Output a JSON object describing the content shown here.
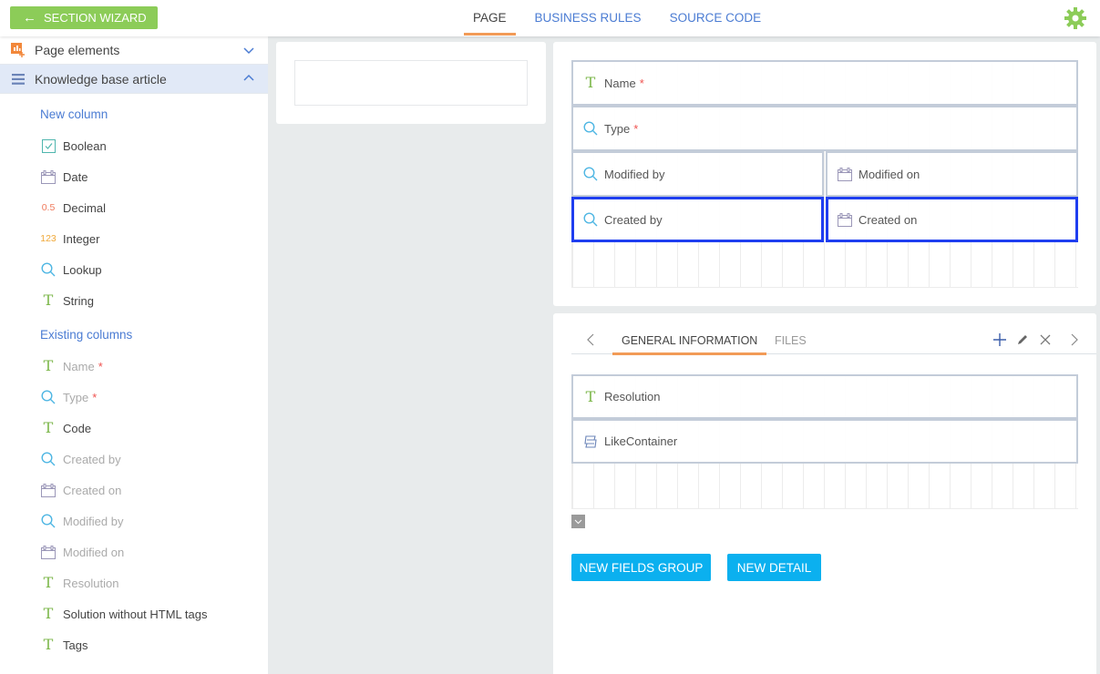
{
  "header": {
    "back_button_label": "SECTION WIZARD",
    "tabs": [
      {
        "label": "PAGE",
        "active": true
      },
      {
        "label": "BUSINESS RULES",
        "active": false
      },
      {
        "label": "SOURCE CODE",
        "active": false
      }
    ],
    "settings_icon": "gear-icon"
  },
  "colors": {
    "accent_green": "#8ccc58",
    "link_blue": "#4b7cd3",
    "tab_underline": "#f29b57",
    "selection_blue": "#1f3ef0",
    "button_blue": "#0bb0ef",
    "required_red": "#ef5350"
  },
  "sidebar": {
    "page_elements_label": "Page elements",
    "object_label": "Knowledge base article",
    "new_column_heading": "New column",
    "new_columns": [
      {
        "label": "Boolean",
        "icon": "checkbox-icon"
      },
      {
        "label": "Date",
        "icon": "calendar-icon"
      },
      {
        "label": "Decimal",
        "icon": "decimal-icon",
        "glyph": "0.5"
      },
      {
        "label": "Integer",
        "icon": "integer-icon",
        "glyph": "123"
      },
      {
        "label": "Lookup",
        "icon": "search-icon"
      },
      {
        "label": "String",
        "icon": "text-icon",
        "glyph": "T"
      }
    ],
    "existing_columns_heading": "Existing columns",
    "existing_columns": [
      {
        "label": "Name",
        "icon": "text-icon",
        "required": "*",
        "used": true
      },
      {
        "label": "Type",
        "icon": "search-icon",
        "required": "*",
        "used": true
      },
      {
        "label": "Code",
        "icon": "text-icon",
        "used": false
      },
      {
        "label": "Created by",
        "icon": "search-icon",
        "used": true
      },
      {
        "label": "Created on",
        "icon": "calendar-icon",
        "used": true
      },
      {
        "label": "Modified by",
        "icon": "search-icon",
        "used": true
      },
      {
        "label": "Modified on",
        "icon": "calendar-icon",
        "used": true
      },
      {
        "label": "Resolution",
        "icon": "text-icon",
        "used": true
      },
      {
        "label": "Solution without HTML tags",
        "icon": "text-icon",
        "used": false
      },
      {
        "label": "Tags",
        "icon": "text-icon",
        "used": false
      }
    ]
  },
  "header_fields": {
    "name": {
      "label": "Name",
      "required": "*"
    },
    "type": {
      "label": "Type",
      "required": "*"
    },
    "modified_by": {
      "label": "Modified by"
    },
    "modified_on": {
      "label": "Modified on"
    },
    "created_by": {
      "label": "Created by",
      "selected": true
    },
    "created_on": {
      "label": "Created on",
      "selected": true
    }
  },
  "tabs_panel": {
    "tabs": [
      {
        "label": "GENERAL INFORMATION",
        "active": true
      },
      {
        "label": "FILES",
        "active": false
      }
    ],
    "fields": {
      "resolution": {
        "label": "Resolution"
      },
      "like_container": {
        "label": "LikeContainer"
      }
    },
    "new_fields_group_label": "NEW FIELDS GROUP",
    "new_detail_label": "NEW DETAIL"
  },
  "glyphs": {
    "text": "T",
    "decimal": "0.5",
    "integer": "123",
    "back_arrow": "←"
  }
}
